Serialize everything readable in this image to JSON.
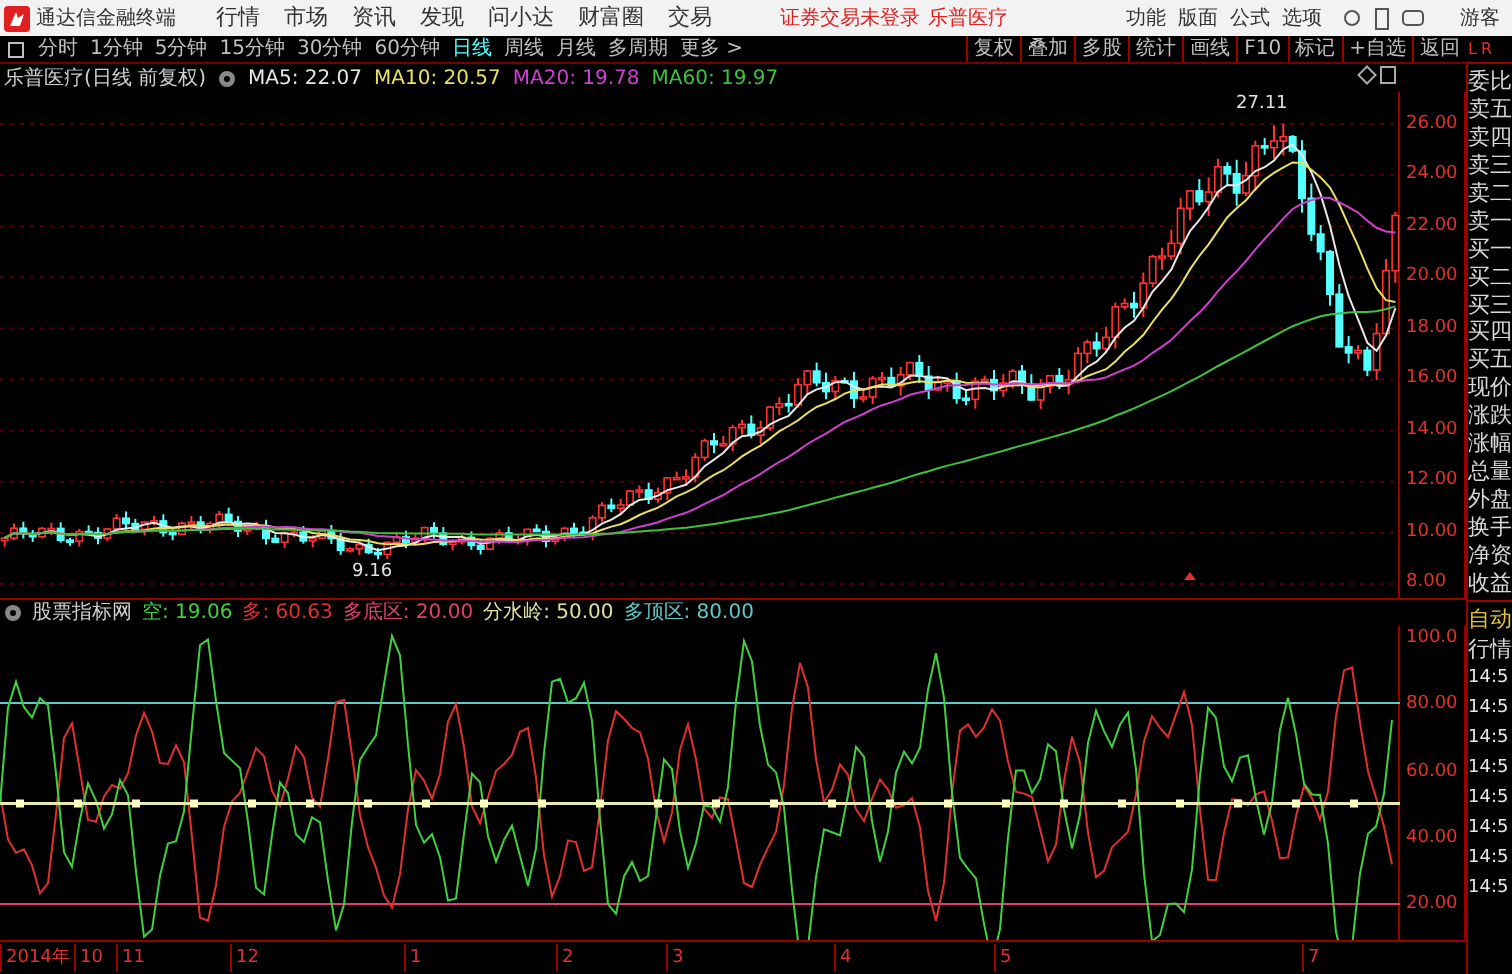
{
  "app": {
    "title": "通达信金融终端",
    "menu": [
      "行情",
      "市场",
      "资讯",
      "发现",
      "问小达",
      "财富圈",
      "交易"
    ],
    "notice": "证券交易未登录",
    "stock": "乐普医疗",
    "right_menu": [
      "功能",
      "版面",
      "公式",
      "选项"
    ],
    "user": "游客"
  },
  "periods": [
    {
      "label": "分时",
      "selected": false
    },
    {
      "label": "1分钟",
      "selected": false
    },
    {
      "label": "5分钟",
      "selected": false
    },
    {
      "label": "15分钟",
      "selected": false
    },
    {
      "label": "30分钟",
      "selected": false
    },
    {
      "label": "60分钟",
      "selected": false
    },
    {
      "label": "日线",
      "selected": true
    },
    {
      "label": "周线",
      "selected": false
    },
    {
      "label": "月线",
      "selected": false
    },
    {
      "label": "多周期",
      "selected": false
    }
  ],
  "more": "更多 >",
  "tools": [
    "复权",
    "叠加",
    "多股",
    "统计",
    "画线",
    "F10",
    "标记",
    "+自选",
    "返回"
  ],
  "corner": [
    "L",
    "R"
  ],
  "chart": {
    "title": "乐普医疗(日线 前复权)",
    "ma": [
      {
        "label": "MA5: 22.07",
        "color": "#e8e8e8"
      },
      {
        "label": "MA10: 20.57",
        "color": "#e8e060"
      },
      {
        "label": "MA20: 19.78",
        "color": "#d040d0"
      },
      {
        "label": "MA60: 19.97",
        "color": "#40c040"
      }
    ],
    "price_ticks": [
      "26.00",
      "24.00",
      "22.00",
      "20.00",
      "18.00",
      "16.00",
      "14.00",
      "12.00",
      "10.00",
      "8.00"
    ],
    "high_label": "27.11",
    "low_label": "9.16"
  },
  "quote_labels": [
    "委比",
    "卖五",
    "卖四",
    "卖三",
    "卖二",
    "卖一",
    "买一",
    "买二",
    "买三",
    "买四",
    "买五",
    "现价",
    "涨跌",
    "涨幅",
    "总量",
    "外盘",
    "换手",
    "净资",
    "收益"
  ],
  "indicator": {
    "name": "股票指标网",
    "values": [
      {
        "label": "空: 19.06",
        "color": "#40d040"
      },
      {
        "label": "多: 60.63",
        "color": "#e03030"
      },
      {
        "label": "多底区: 20.00",
        "color": "#e04070"
      },
      {
        "label": "分水岭: 50.00",
        "color": "#e0e0a0"
      },
      {
        "label": "多顶区: 80.00",
        "color": "#60c8c8"
      }
    ],
    "ticks": [
      "100.0",
      "80.00",
      "60.00",
      "40.00",
      "20.00"
    ]
  },
  "side_bottom": {
    "mode": "自动",
    "label": "行情",
    "times": [
      "14:5",
      "14:5",
      "14:5",
      "14:5",
      "14:5",
      "14:5",
      "14:5",
      "14:5"
    ]
  },
  "date_axis": [
    "2014年",
    "10",
    "11",
    "12",
    "1",
    "2",
    "3",
    "4",
    "5",
    "7"
  ]
}
